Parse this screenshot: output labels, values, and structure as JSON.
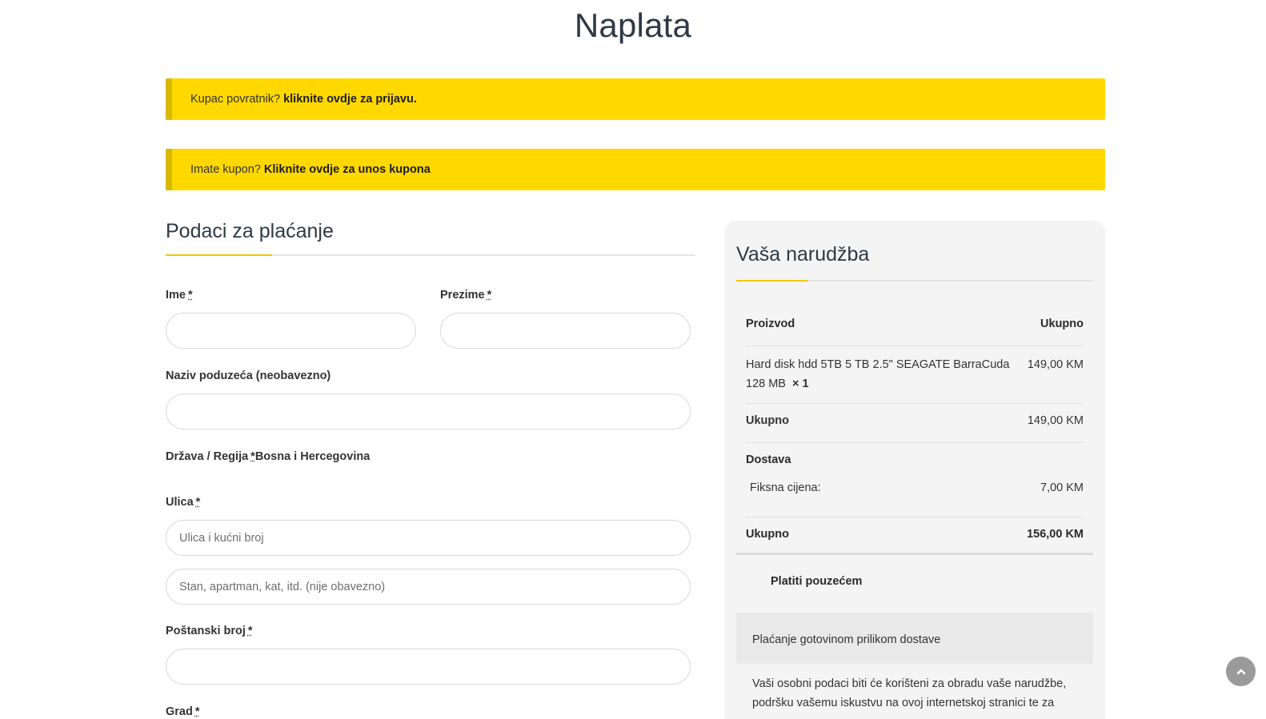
{
  "page": {
    "title": "Naplata"
  },
  "notices": {
    "login_text": "Kupac povratnik?",
    "login_link": "kliknite ovdje za prijavu.",
    "coupon_text": "Imate kupon?",
    "coupon_link": "Kliknite ovdje za unos kupona"
  },
  "billing": {
    "title": "Podaci za plaćanje",
    "first_name_label": "Ime",
    "last_name_label": "Prezime",
    "company_label": "Naziv poduzeća (neobavezno)",
    "country_label": "Država / Regija",
    "country_value": "Bosna i Hercegovina",
    "street_label": "Ulica",
    "street_placeholder": "Ulica i kućni broj",
    "street2_placeholder": "Stan, apartman, kat, itd. (nije obavezno)",
    "postcode_label": "Poštanski broj",
    "city_label": "Grad",
    "required_mark": "*"
  },
  "order": {
    "title": "Vaša narudžba",
    "col_product": "Proizvod",
    "col_total": "Ukupno",
    "item_name": "Hard disk hdd 5TB 5 TB 2.5\" SEAGATE BarraCuda 128 MB",
    "item_qty": "× 1",
    "item_price": "149,00 KM",
    "subtotal_label": "Ukupno",
    "subtotal_value": "149,00 KM",
    "shipping_label": "Dostava",
    "shipping_method": "Fiksna cijena:",
    "shipping_value": "7,00 KM",
    "total_label": "Ukupno",
    "total_value": "156,00 KM",
    "payment_method": "Platiti pouzećem",
    "payment_desc": "Plaćanje gotovinom prilikom dostave",
    "privacy_text": "Vaši osobni podaci biti će korišteni za obradu vaše narudžbe, podršku vašemu iskustvu na ovoj internetskoj stranici te za"
  },
  "icons": {
    "scroll_top": "chevron-up-icon"
  },
  "colors": {
    "notice_bg": "#ffd800",
    "accent": "#f0c800"
  }
}
